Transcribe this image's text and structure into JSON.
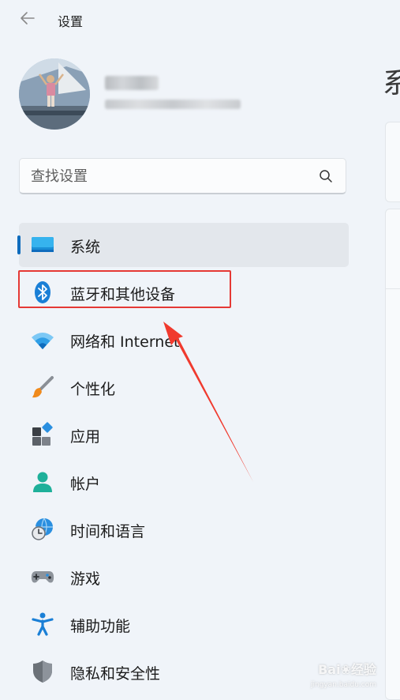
{
  "window": {
    "title": "设置"
  },
  "search": {
    "placeholder": "查找设置"
  },
  "nav": {
    "items": [
      {
        "label": "系统",
        "icon": "monitor-icon",
        "selected": true
      },
      {
        "label": "蓝牙和其他设备",
        "icon": "bluetooth-icon",
        "selected": false
      },
      {
        "label": "网络和 Internet",
        "icon": "wifi-icon",
        "selected": false
      },
      {
        "label": "个性化",
        "icon": "paintbrush-icon",
        "selected": false
      },
      {
        "label": "应用",
        "icon": "apps-icon",
        "selected": false
      },
      {
        "label": "帐户",
        "icon": "account-icon",
        "selected": false
      },
      {
        "label": "时间和语言",
        "icon": "globe-clock-icon",
        "selected": false
      },
      {
        "label": "游戏",
        "icon": "gamepad-icon",
        "selected": false
      },
      {
        "label": "辅助功能",
        "icon": "accessibility-icon",
        "selected": false
      },
      {
        "label": "隐私和安全性",
        "icon": "shield-icon",
        "selected": false
      }
    ]
  },
  "main": {
    "title": "系"
  },
  "watermark": {
    "text": "Bai❀经验",
    "sub": "jingyan.baidu.com"
  },
  "colors": {
    "accent": "#0f6cbd",
    "highlight": "#e53935",
    "background": "#f0f4f9"
  }
}
